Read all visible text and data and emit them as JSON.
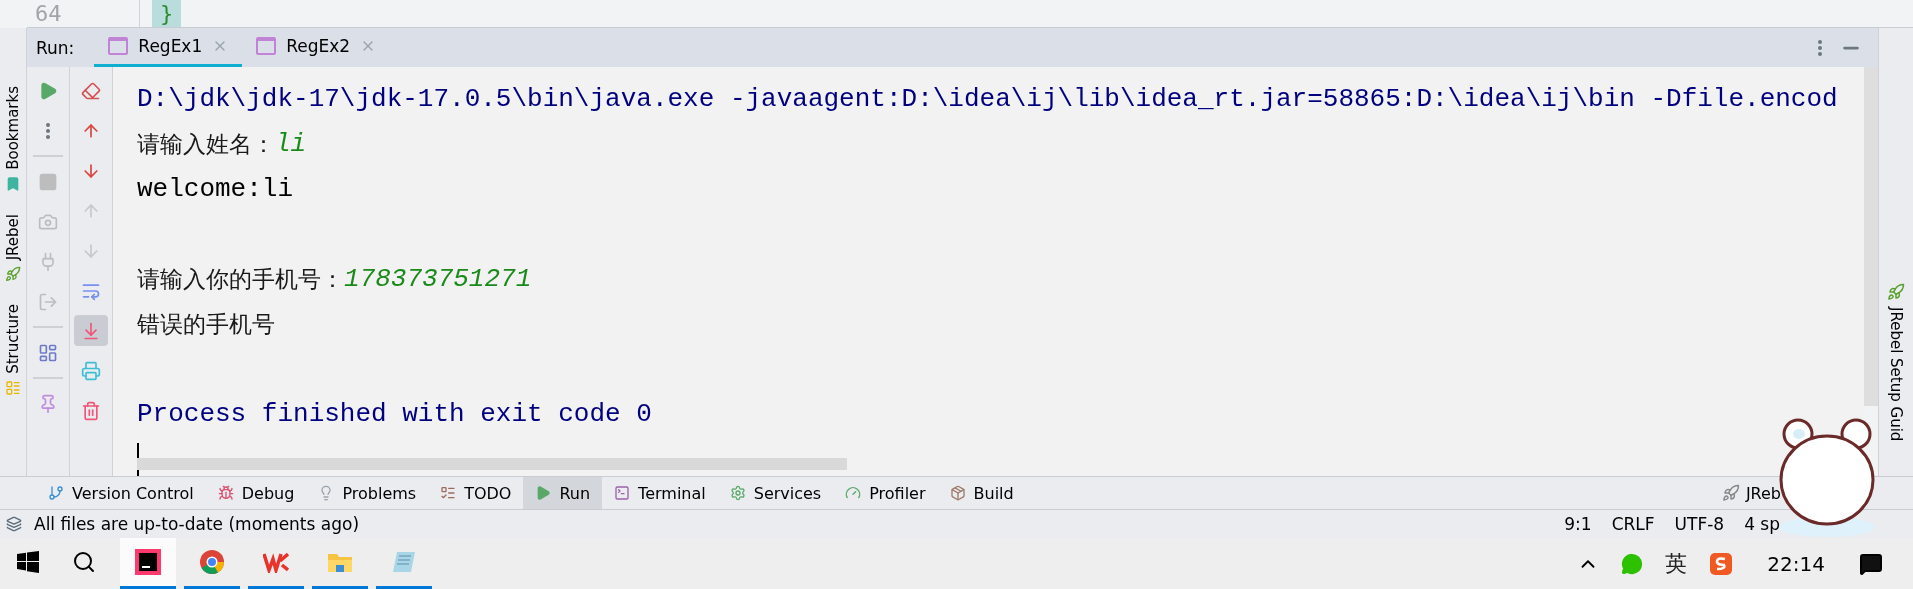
{
  "editor": {
    "line_number": "64",
    "code": "}"
  },
  "left_strip": [
    {
      "label": "Bookmarks",
      "kind": "bookmarks"
    },
    {
      "label": "JRebel",
      "kind": "rocket"
    },
    {
      "label": "Structure",
      "kind": "structure"
    }
  ],
  "run_panel": {
    "label": "Run:",
    "tabs": [
      {
        "label": "RegEx1",
        "selected": true
      },
      {
        "label": "RegEx2",
        "selected": false
      }
    ],
    "toolbar_left": [
      {
        "kind": "rerun",
        "disabled": false
      },
      {
        "kind": "more",
        "disabled": false
      },
      {
        "kind": "sep"
      },
      {
        "kind": "stop",
        "disabled": true
      },
      {
        "kind": "camera",
        "disabled": true
      },
      {
        "kind": "plug",
        "disabled": true
      },
      {
        "kind": "exit",
        "disabled": true
      },
      {
        "kind": "sep"
      },
      {
        "kind": "layout",
        "disabled": false
      },
      {
        "kind": "sep"
      },
      {
        "kind": "pin",
        "disabled": false
      }
    ],
    "toolbar_right": [
      {
        "kind": "clear",
        "on": false,
        "disabled": false
      },
      {
        "kind": "up",
        "on": false,
        "disabled": false
      },
      {
        "kind": "down",
        "on": false,
        "disabled": false
      },
      {
        "kind": "up",
        "on": false,
        "disabled": true
      },
      {
        "kind": "down",
        "on": false,
        "disabled": true
      },
      {
        "kind": "wrap",
        "on": false,
        "disabled": false
      },
      {
        "kind": "scroll_end",
        "on": true,
        "disabled": false
      },
      {
        "kind": "print",
        "on": false,
        "disabled": false
      },
      {
        "kind": "trash",
        "on": false,
        "disabled": false
      }
    ],
    "console": [
      {
        "kind": "command",
        "text": "D:\\jdk\\jdk-17\\jdk-17.0.5\\bin\\java.exe -javaagent:D:\\idea\\ij\\lib\\idea_rt.jar=58865:D:\\idea\\ij\\bin -Dfile.encod"
      },
      {
        "kind": "prompt",
        "text": "请输入姓名：",
        "input": "li"
      },
      {
        "kind": "output",
        "text": "welcome:li"
      },
      {
        "kind": "blank"
      },
      {
        "kind": "prompt",
        "text": "请输入你的手机号：",
        "input": "178373751271"
      },
      {
        "kind": "output",
        "text": "错误的手机号"
      },
      {
        "kind": "blank"
      },
      {
        "kind": "system",
        "text": "Process finished with exit code 0"
      }
    ]
  },
  "right_strip": {
    "label": "JRebel Setup Guid"
  },
  "tool_windows": [
    {
      "label": "Version Control",
      "kind": "vcs",
      "selected": false
    },
    {
      "label": "Debug",
      "kind": "debug",
      "selected": false
    },
    {
      "label": "Problems",
      "kind": "problems",
      "selected": false
    },
    {
      "label": "TODO",
      "kind": "todo",
      "selected": false
    },
    {
      "label": "Run",
      "kind": "run",
      "selected": true
    },
    {
      "label": "Terminal",
      "kind": "terminal",
      "selected": false
    },
    {
      "label": "Services",
      "kind": "services",
      "selected": false
    },
    {
      "label": "Profiler",
      "kind": "profiler",
      "selected": false
    },
    {
      "label": "Build",
      "kind": "build",
      "selected": false
    }
  ],
  "tool_windows_right": {
    "label": "JReb"
  },
  "status_bar": {
    "message": "All files are up-to-date (moments ago)",
    "items": [
      "9:1",
      "CRLF",
      "UTF-8",
      "4 sp"
    ]
  },
  "taskbar": {
    "apps": [
      {
        "kind": "intellij",
        "selected": true
      },
      {
        "kind": "chrome",
        "selected": false
      },
      {
        "kind": "wps",
        "selected": false
      },
      {
        "kind": "folder",
        "selected": false
      },
      {
        "kind": "notepad",
        "selected": false
      }
    ],
    "input_method": "英",
    "time": "22:14"
  }
}
